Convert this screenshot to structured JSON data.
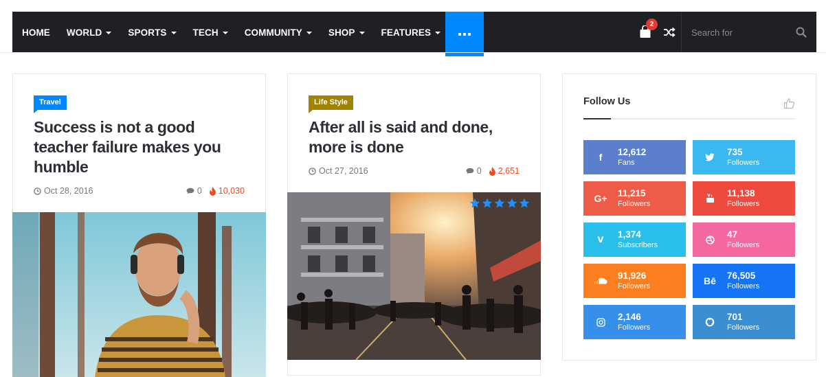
{
  "nav": {
    "items": [
      {
        "label": "HOME",
        "dropdown": false
      },
      {
        "label": "WORLD",
        "dropdown": true
      },
      {
        "label": "SPORTS",
        "dropdown": true
      },
      {
        "label": "TECH",
        "dropdown": true
      },
      {
        "label": "COMMUNITY",
        "dropdown": true
      },
      {
        "label": "SHOP",
        "dropdown": true
      },
      {
        "label": "FEATURES",
        "dropdown": true
      }
    ],
    "more_icon": "ellipsis-icon",
    "cart_count": "2",
    "search_placeholder": "Search for"
  },
  "posts": [
    {
      "category": "Travel",
      "category_color": "#0088ff",
      "title": "Success is not a good teacher failure makes you humble",
      "date": "Oct 28, 2016",
      "comments": "0",
      "views": "10,030"
    },
    {
      "category": "Life Style",
      "category_color": "#a18300",
      "title": "After all is said and done, more is done",
      "date": "Oct 27, 2016",
      "comments": "0",
      "views": "2,651",
      "rating_stars": 5
    }
  ],
  "widget": {
    "title": "Follow Us",
    "socials": [
      {
        "icon": "facebook-icon",
        "count": "12,612",
        "label": "Fans",
        "color": "#5b7fcc"
      },
      {
        "icon": "twitter-icon",
        "count": "735",
        "label": "Followers",
        "color": "#3ab8ef"
      },
      {
        "icon": "google-plus-icon",
        "count": "11,215",
        "label": "Followers",
        "color": "#ee5b46"
      },
      {
        "icon": "youtube-icon",
        "count": "11,138",
        "label": "Followers",
        "color": "#ee4a3d"
      },
      {
        "icon": "vimeo-icon",
        "count": "1,374",
        "label": "Subscribers",
        "color": "#29bfea"
      },
      {
        "icon": "dribbble-icon",
        "count": "47",
        "label": "Followers",
        "color": "#f567a0"
      },
      {
        "icon": "soundcloud-icon",
        "count": "91,926",
        "label": "Followers",
        "color": "#fb7e1f"
      },
      {
        "icon": "behance-icon",
        "count": "76,505",
        "label": "Followers",
        "color": "#1474f4"
      },
      {
        "icon": "instagram-icon",
        "count": "2,146",
        "label": "Followers",
        "color": "#368fe8"
      },
      {
        "icon": "github-icon",
        "count": "701",
        "label": "Followers",
        "color": "#3b8fd0"
      }
    ]
  }
}
